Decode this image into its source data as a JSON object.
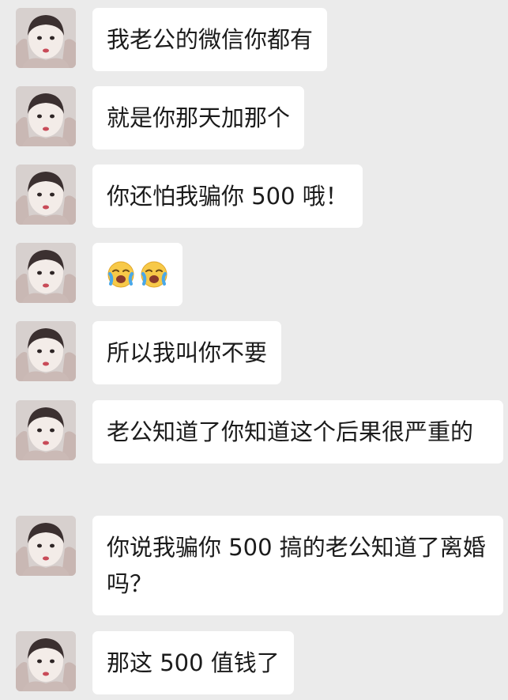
{
  "conversation": {
    "messages": [
      {
        "text": "我老公的微信你都有"
      },
      {
        "text": "就是你那天加那个"
      },
      {
        "text": "你还怕我骗你 500 哦！"
      },
      {
        "text": "",
        "emojis": [
          "loudly-crying-face",
          "loudly-crying-face"
        ]
      },
      {
        "text": "所以我叫你不要"
      },
      {
        "text": "老公知道了你知道这个后果很严重的"
      },
      {
        "text": "你说我骗你 500 搞的老公知道了离婚吗？"
      },
      {
        "text": "那这 500 值钱了"
      }
    ]
  },
  "colors": {
    "background": "#ebebeb",
    "bubble": "#ffffff",
    "text": "#1b1b1b"
  }
}
